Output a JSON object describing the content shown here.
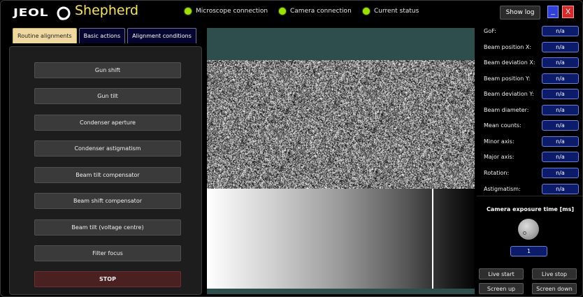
{
  "app": {
    "logo_text": "JEOL",
    "title": "Shepherd"
  },
  "status": [
    {
      "label": "Microscope connection",
      "color": "#9be000"
    },
    {
      "label": "Camera connection",
      "color": "#9be000"
    },
    {
      "label": "Current status",
      "color": "#9be000"
    }
  ],
  "window_buttons": {
    "show_log": "Show log",
    "minimize": "_",
    "close": "X"
  },
  "tabs": [
    {
      "label": "Routine alignments",
      "active": true
    },
    {
      "label": "Basic actions",
      "active": false
    },
    {
      "label": "Alignment conditions",
      "active": false
    }
  ],
  "alignments": [
    "Gun shift",
    "Gun tilt",
    "Condenser aperture",
    "Condenser astigmatism",
    "Beam tilt compensator",
    "Beam shift compensator",
    "Beam tilt (voltage centre)",
    "Filter focus"
  ],
  "stop_label": "STOP",
  "parameters": [
    {
      "label": "GoF:",
      "value": "n/a"
    },
    {
      "label": "Beam position X:",
      "value": "n/a"
    },
    {
      "label": "Beam deviation X:",
      "value": "n/a"
    },
    {
      "label": "Beam position Y:",
      "value": "n/a"
    },
    {
      "label": "Beam deviation Y:",
      "value": "n/a"
    },
    {
      "label": "Beam diameter:",
      "value": "n/a"
    },
    {
      "label": "Mean counts:",
      "value": "n/a"
    },
    {
      "label": "Minor axis:",
      "value": "n/a"
    },
    {
      "label": "Major axis:",
      "value": "n/a"
    },
    {
      "label": "Rotation:",
      "value": "n/a"
    },
    {
      "label": "Astigmatism:",
      "value": "n/a"
    }
  ],
  "exposure": {
    "title": "Camera exposure time [ms]",
    "value": "1"
  },
  "camera_buttons": {
    "live_start": "Live start",
    "live_stop": "Live stop",
    "screen_up": "Screen up",
    "screen_down": "Screen down"
  },
  "colors": {
    "accent_title": "#f5e26a",
    "status_ok": "#9be000",
    "value_box": "#0c1c6a",
    "tab_active": "#f0d9a0",
    "camera_bg": "#2e4d4d"
  }
}
